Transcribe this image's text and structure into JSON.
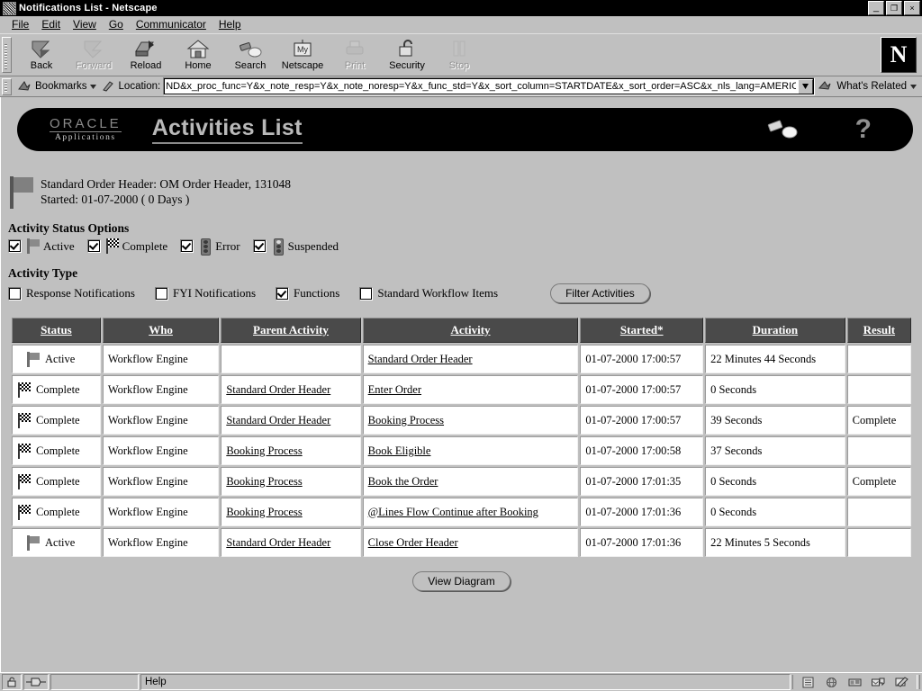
{
  "window": {
    "title": "Notifications List - Netscape",
    "buttons": {
      "minimize": "_",
      "restore": "❐",
      "close": "×"
    }
  },
  "menu": {
    "items": [
      "File",
      "Edit",
      "View",
      "Go",
      "Communicator",
      "Help"
    ]
  },
  "toolbar": {
    "items": [
      {
        "label": "Back",
        "icon": "back-arrow-icon",
        "disabled": false
      },
      {
        "label": "Forward",
        "icon": "forward-arrow-icon",
        "disabled": true
      },
      {
        "label": "Reload",
        "icon": "reload-icon",
        "disabled": false
      },
      {
        "label": "Home",
        "icon": "home-icon",
        "disabled": false
      },
      {
        "label": "Search",
        "icon": "search-flashlight-icon",
        "disabled": false
      },
      {
        "label": "Netscape",
        "icon": "my-netscape-icon",
        "disabled": false
      },
      {
        "label": "Print",
        "icon": "printer-icon",
        "disabled": true
      },
      {
        "label": "Security",
        "icon": "padlock-icon",
        "disabled": false
      },
      {
        "label": "Stop",
        "icon": "stop-icon",
        "disabled": true
      }
    ],
    "logo_letter": "N"
  },
  "location_bar": {
    "bookmarks_label": "Bookmarks",
    "location_label": "Location:",
    "url": "ND&x_proc_func=Y&x_note_resp=Y&x_note_noresp=Y&x_func_std=Y&x_sort_column=STARTDATE&x_sort_order=ASC&x_nls_lang=AMERICAN",
    "url_placeholder": "Location:",
    "whats_related": "What's Related"
  },
  "banner": {
    "brand": "ORACLE",
    "brand_sub": "Applications",
    "title": "Activities List",
    "search_icon": "flashlight-icon",
    "help_icon": "question-mark-icon",
    "help_glyph": "?"
  },
  "order_header": {
    "line1": "Standard Order Header: OM Order Header, 131048",
    "line2": "Started: 01-07-2000 ( 0 Days )",
    "icon": "gray-flag-icon"
  },
  "status_options": {
    "title": "Activity Status Options",
    "items": [
      {
        "label": "Active",
        "checked": true,
        "icon": "gray-flag-icon"
      },
      {
        "label": "Complete",
        "checked": true,
        "icon": "checkered-flag-icon"
      },
      {
        "label": "Error",
        "checked": true,
        "icon": "traffic-light-icon"
      },
      {
        "label": "Suspended",
        "checked": true,
        "icon": "traffic-light-suspended-icon"
      }
    ]
  },
  "activity_type": {
    "title": "Activity Type",
    "items": [
      {
        "label": "Response Notifications",
        "checked": false
      },
      {
        "label": "FYI Notifications",
        "checked": false
      },
      {
        "label": "Functions",
        "checked": true
      },
      {
        "label": "Standard Workflow Items",
        "checked": false
      }
    ],
    "filter_button": "Filter Activities"
  },
  "table": {
    "headers": [
      "Status",
      "Who",
      "Parent Activity",
      "Activity",
      "Started*",
      "Duration",
      "Result"
    ],
    "rows": [
      {
        "status": "Active",
        "status_icon": "gray-flag-icon",
        "who": "Workflow Engine",
        "parent": "",
        "activity": "Standard Order Header",
        "started": "01-07-2000 17:00:57",
        "duration": "22 Minutes 44 Seconds",
        "result": ""
      },
      {
        "status": "Complete",
        "status_icon": "checkered-flag-icon",
        "who": "Workflow Engine",
        "parent": "Standard Order Header",
        "activity": "Enter Order",
        "started": "01-07-2000 17:00:57",
        "duration": "0 Seconds",
        "result": ""
      },
      {
        "status": "Complete",
        "status_icon": "checkered-flag-icon",
        "who": "Workflow Engine",
        "parent": "Standard Order Header",
        "activity": "Booking Process",
        "started": "01-07-2000 17:00:57",
        "duration": "39 Seconds",
        "result": "Complete"
      },
      {
        "status": "Complete",
        "status_icon": "checkered-flag-icon",
        "who": "Workflow Engine",
        "parent": "Booking Process",
        "activity": "Book Eligible",
        "started": "01-07-2000 17:00:58",
        "duration": "37 Seconds",
        "result": ""
      },
      {
        "status": "Complete",
        "status_icon": "checkered-flag-icon",
        "who": "Workflow Engine",
        "parent": "Booking Process",
        "activity": "Book the Order",
        "started": "01-07-2000 17:01:35",
        "duration": "0 Seconds",
        "result": "Complete"
      },
      {
        "status": "Complete",
        "status_icon": "checkered-flag-icon",
        "who": "Workflow Engine",
        "parent": "Booking Process",
        "activity": "@Lines Flow Continue after Booking",
        "started": "01-07-2000 17:01:36",
        "duration": "0 Seconds",
        "result": ""
      },
      {
        "status": "Active",
        "status_icon": "gray-flag-icon",
        "who": "Workflow Engine",
        "parent": "Standard Order Header",
        "activity": "Close Order Header",
        "started": "01-07-2000 17:01:36",
        "duration": "22 Minutes 5 Seconds",
        "result": ""
      }
    ]
  },
  "view_diagram_button": "View Diagram",
  "status_bar": {
    "message": "Help",
    "lock_icon": "padlock-icon",
    "connection_icon": "connection-icon",
    "components": [
      "navigator-icon",
      "mailbox-icon",
      "newsgroups-icon",
      "address-book-icon",
      "composer-icon"
    ]
  },
  "colors": {
    "chrome": "#c0c0c0",
    "banner_bg": "#000000",
    "table_header_bg": "#4a4a4a",
    "titlebar_bg": "#000000"
  }
}
